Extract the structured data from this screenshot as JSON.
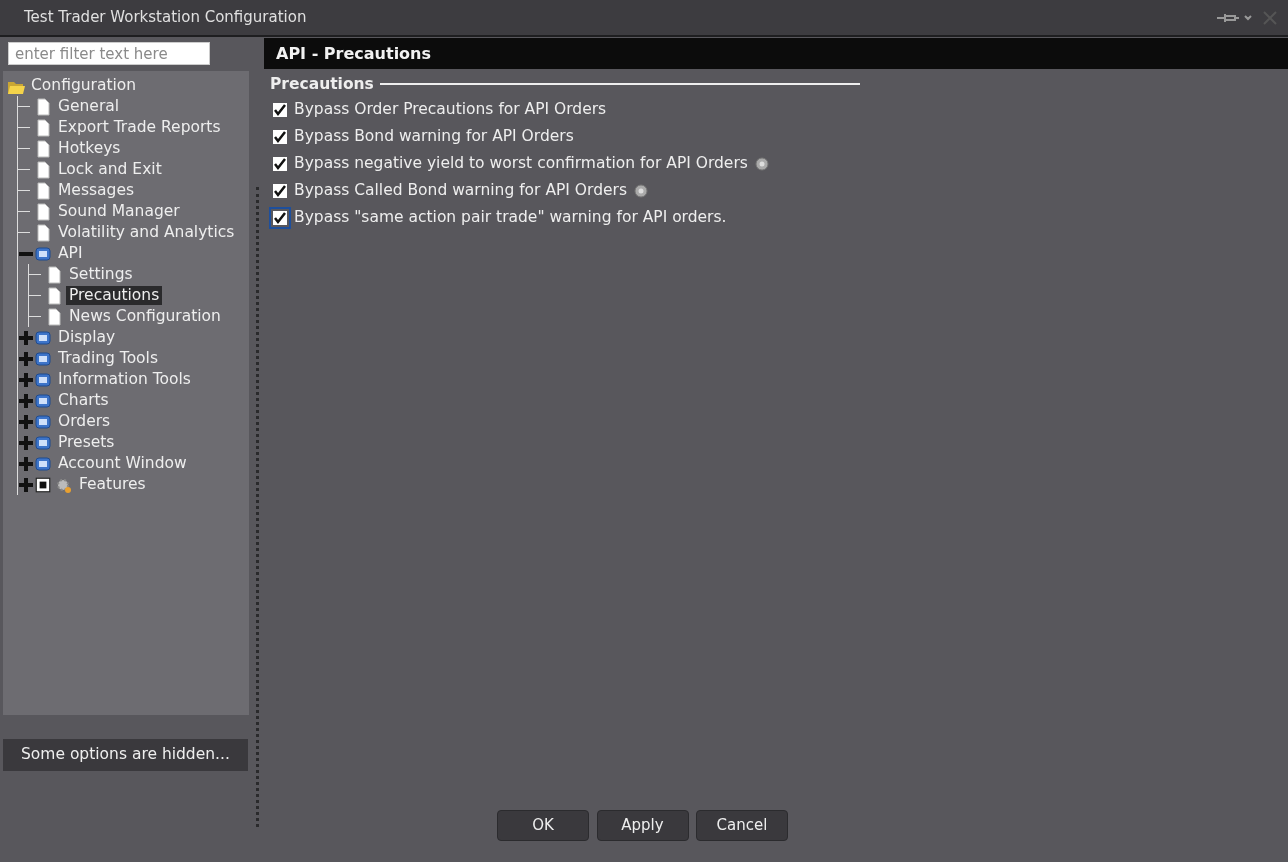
{
  "window": {
    "title": "Test Trader Workstation Configuration"
  },
  "filter": {
    "placeholder": "enter filter text here"
  },
  "tree": [
    {
      "label": "Configuration",
      "kind": "folder",
      "expanded": true,
      "selected": false,
      "children": [
        {
          "label": "General",
          "kind": "page",
          "selected": false
        },
        {
          "label": "Export Trade Reports",
          "kind": "page",
          "selected": false
        },
        {
          "label": "Hotkeys",
          "kind": "page",
          "selected": false
        },
        {
          "label": "Lock and Exit",
          "kind": "page",
          "selected": false
        },
        {
          "label": "Messages",
          "kind": "page",
          "selected": false
        },
        {
          "label": "Sound Manager",
          "kind": "page",
          "selected": false
        },
        {
          "label": "Volatility and Analytics",
          "kind": "page",
          "selected": false
        },
        {
          "label": "API",
          "kind": "group",
          "expanded": true,
          "selected": false,
          "children": [
            {
              "label": "Settings",
              "kind": "page",
              "selected": false
            },
            {
              "label": "Precautions",
              "kind": "page",
              "selected": true
            },
            {
              "label": "News Configuration",
              "kind": "page",
              "selected": false
            }
          ]
        },
        {
          "label": "Display",
          "kind": "group",
          "expanded": false,
          "selected": false
        },
        {
          "label": "Trading Tools",
          "kind": "group",
          "expanded": false,
          "selected": false
        },
        {
          "label": "Information Tools",
          "kind": "group",
          "expanded": false,
          "selected": false
        },
        {
          "label": "Charts",
          "kind": "group",
          "expanded": false,
          "selected": false
        },
        {
          "label": "Orders",
          "kind": "group",
          "expanded": false,
          "selected": false
        },
        {
          "label": "Presets",
          "kind": "group",
          "expanded": false,
          "selected": false
        },
        {
          "label": "Account Window",
          "kind": "group",
          "expanded": false,
          "selected": false
        },
        {
          "label": "Features",
          "kind": "checkgroup",
          "checked": false,
          "expanded": false,
          "selected": false
        }
      ]
    }
  ],
  "hidden_note": "Some options are hidden...",
  "panel": {
    "title": "API - Precautions",
    "section": "Precautions",
    "options": [
      {
        "label": "Bypass Order Precautions for API Orders",
        "checked": true,
        "info": false,
        "focused": false
      },
      {
        "label": "Bypass Bond warning for API Orders",
        "checked": true,
        "info": false,
        "focused": false
      },
      {
        "label": "Bypass negative yield to worst confirmation for API Orders",
        "checked": true,
        "info": true,
        "focused": false
      },
      {
        "label": "Bypass Called Bond warning for API Orders",
        "checked": true,
        "info": true,
        "focused": false
      },
      {
        "label": "Bypass \"same action pair trade\" warning for API orders.",
        "checked": true,
        "info": false,
        "focused": true
      }
    ]
  },
  "buttons": [
    "OK",
    "Apply",
    "Cancel"
  ]
}
